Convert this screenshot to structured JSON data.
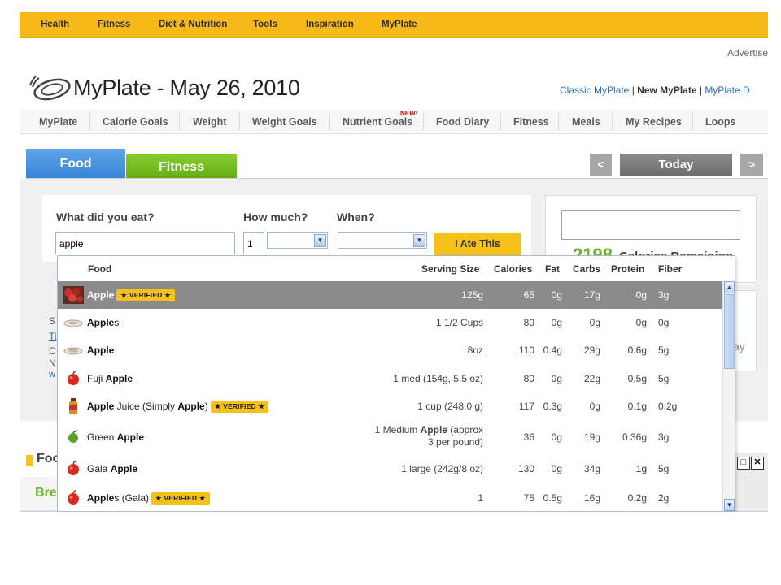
{
  "top_nav": [
    "Health",
    "Fitness",
    "Diet & Nutrition",
    "Tools",
    "Inspiration",
    "MyPlate"
  ],
  "advertise": "Advertise",
  "page_title": "MyPlate - May 26, 2010",
  "version_links": {
    "classic": "Classic MyPlate",
    "sep1": " | ",
    "new": "New MyPlate",
    "sep2": " | ",
    "other": "MyPlate D"
  },
  "sub_nav": {
    "tabs": [
      "MyPlate",
      "Calorie Goals",
      "Weight",
      "Weight Goals",
      "Nutrient Goals",
      "Food Diary",
      "Fitness",
      "Meals",
      "My Recipes",
      "Loops"
    ],
    "new_badge": "NEW!"
  },
  "mode_tabs": {
    "food": "Food",
    "fitness": "Fitness"
  },
  "date_nav": {
    "prev": "<",
    "today": "Today",
    "next": ">"
  },
  "entry": {
    "what_label": "What did you eat?",
    "how_much_label": "How much?",
    "when_label": "When?",
    "search_value": "apple",
    "quantity_value": "1",
    "submit_label": "I Ate This"
  },
  "calories_box": {
    "number": "2198",
    "text": "Calories Remaining"
  },
  "side_peek": {
    "text": "ay"
  },
  "left_peek": [
    "S",
    "Ti",
    "C",
    "N",
    "w"
  ],
  "foods_section": {
    "title": "Foods",
    "breakfast": "Breakfast"
  },
  "window_controls": {
    "maximize": "□",
    "close": "✕"
  },
  "dropdown": {
    "headers": {
      "food": "Food",
      "serving": "Serving Size",
      "calories": "Calories",
      "fat": "Fat",
      "carbs": "Carbs",
      "protein": "Protein",
      "fiber": "Fiber"
    },
    "verified_label": "★ VERIFIED ★",
    "rows": [
      {
        "parts": [
          {
            "b": "Apple"
          }
        ],
        "verified": true,
        "serving": "125g",
        "serving2": "",
        "calories": "65",
        "fat": "0g",
        "carbs": "17g",
        "protein": "0g",
        "fiber": "3g",
        "icon": "apples-photo-icon"
      },
      {
        "parts": [
          {
            "b": "Apple"
          },
          {
            "t": "s"
          }
        ],
        "verified": false,
        "serving": "1 1/2 Cups",
        "serving2": "",
        "calories": "80",
        "fat": "0g",
        "carbs": "0g",
        "protein": "0g",
        "fiber": "0g",
        "icon": "plate-icon"
      },
      {
        "parts": [
          {
            "b": "Apple"
          }
        ],
        "verified": false,
        "serving": "8oz",
        "serving2": "",
        "calories": "110",
        "fat": "0.4g",
        "carbs": "29g",
        "protein": "0.6g",
        "fiber": "5g",
        "icon": "plate-icon"
      },
      {
        "parts": [
          {
            "t": "Fuji "
          },
          {
            "b": "Apple"
          }
        ],
        "verified": false,
        "serving": "1 med (154g, 5.5 oz)",
        "serving2": "",
        "calories": "80",
        "fat": "0g",
        "carbs": "22g",
        "protein": "0.5g",
        "fiber": "5g",
        "icon": "red-apple-icon"
      },
      {
        "parts": [
          {
            "b": "Apple"
          },
          {
            "t": " Juice (Simply "
          },
          {
            "b": "Apple"
          },
          {
            "t": ")"
          }
        ],
        "verified": true,
        "serving": "1 cup (248.0 g)",
        "serving2": "",
        "calories": "117",
        "fat": "0.3g",
        "carbs": "0g",
        "protein": "0.1g",
        "fiber": "0.2g",
        "icon": "juice-bottle-icon"
      },
      {
        "parts": [
          {
            "t": "Green "
          },
          {
            "b": "Apple"
          }
        ],
        "verified": false,
        "serving_parts": [
          {
            "t": "1 Medium "
          },
          {
            "b": "Apple"
          },
          {
            "t": " (approx"
          }
        ],
        "serving": "",
        "serving2": "3 per pound)",
        "calories": "36",
        "fat": "0g",
        "carbs": "19g",
        "protein": "0.36g",
        "fiber": "3g",
        "icon": "green-apple-icon"
      },
      {
        "parts": [
          {
            "t": "Gala "
          },
          {
            "b": "Apple"
          }
        ],
        "verified": false,
        "serving": "1 large (242g/8 oz)",
        "serving2": "",
        "calories": "130",
        "fat": "0g",
        "carbs": "34g",
        "protein": "1g",
        "fiber": "5g",
        "icon": "red-apple-icon"
      },
      {
        "parts": [
          {
            "b": "Apple"
          },
          {
            "t": "s (Gala)"
          }
        ],
        "verified": true,
        "serving": "1",
        "serving2": "",
        "calories": "75",
        "fat": "0.5g",
        "carbs": "16g",
        "protein": "0.2g",
        "fiber": "2g",
        "icon": "red-apple-icon"
      }
    ]
  },
  "colors": {
    "top_nav_bg": "#f7b918",
    "food_tab": "#3a83d6",
    "fitness_tab": "#63ad17",
    "selected_row": "#8b8b8b",
    "verified_badge": "#f4c21a",
    "calories_green": "#6db22c"
  }
}
